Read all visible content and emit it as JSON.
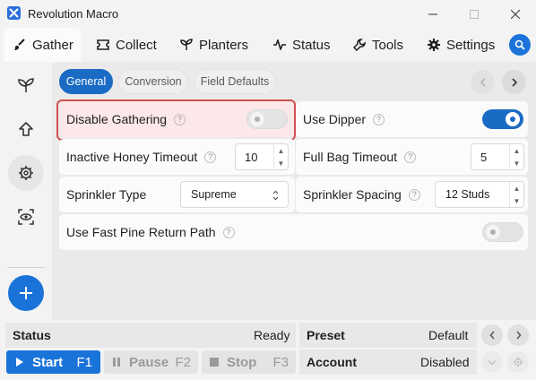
{
  "app": {
    "title": "Revolution Macro"
  },
  "tabs": [
    {
      "label": "Gather",
      "icon": "brush-icon",
      "active": true
    },
    {
      "label": "Collect",
      "icon": "ticket-icon"
    },
    {
      "label": "Planters",
      "icon": "sprout-icon"
    },
    {
      "label": "Status",
      "icon": "pulse-icon"
    },
    {
      "label": "Tools",
      "icon": "wrench-icon"
    },
    {
      "label": "Settings",
      "icon": "gear-icon"
    }
  ],
  "subtabs": [
    {
      "label": "General",
      "active": true
    },
    {
      "label": "Conversion"
    },
    {
      "label": "Field Defaults"
    }
  ],
  "settings": {
    "disable_gathering": {
      "label": "Disable Gathering",
      "help": "?",
      "enabled": false
    },
    "use_dipper": {
      "label": "Use Dipper",
      "help": "?",
      "enabled": true
    },
    "inactive_honey_timeout": {
      "label": "Inactive Honey Timeout",
      "help": "?",
      "value": "10"
    },
    "full_bag_timeout": {
      "label": "Full Bag Timeout",
      "help": "?",
      "value": "5"
    },
    "sprinkler_type": {
      "label": "Sprinkler Type",
      "help": "?",
      "value": "Supreme"
    },
    "sprinkler_spacing": {
      "label": "Sprinkler Spacing",
      "help": "?",
      "value": "12 Studs"
    },
    "fast_pine_return": {
      "label": "Use Fast Pine Return Path",
      "help": "?",
      "enabled": false
    }
  },
  "status_bar": {
    "status_label": "Status",
    "status_value": "Ready",
    "preset_label": "Preset",
    "preset_value": "Default",
    "account_label": "Account",
    "account_value": "Disabled",
    "start": {
      "label": "Start",
      "key": "F1"
    },
    "pause": {
      "label": "Pause",
      "key": "F2"
    },
    "stop": {
      "label": "Stop",
      "key": "F3"
    }
  },
  "colors": {
    "accent": "#1a73d9",
    "accent_dark": "#1a6bc4",
    "highlight": "#d05050"
  }
}
